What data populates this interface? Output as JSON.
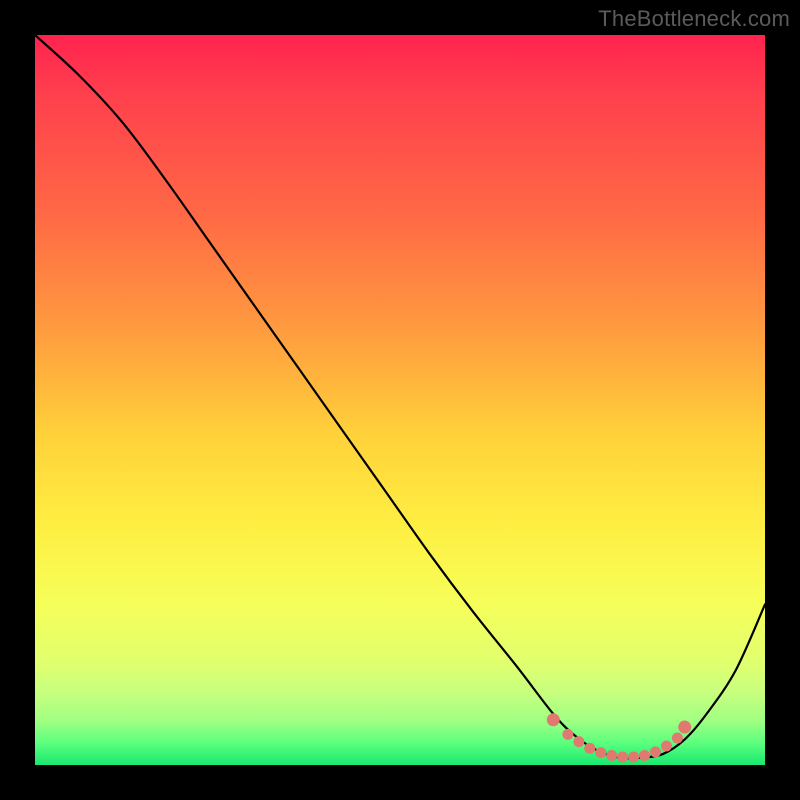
{
  "watermark": "TheBottleneck.com",
  "chart_data": {
    "type": "line",
    "title": "",
    "xlabel": "",
    "ylabel": "",
    "xlim": [
      0,
      100
    ],
    "ylim": [
      0,
      100
    ],
    "series": [
      {
        "name": "curve",
        "x": [
          0,
          6,
          12,
          18,
          24,
          30,
          36,
          42,
          48,
          54,
          60,
          66,
          71,
          74,
          77,
          80,
          83,
          86,
          89,
          92,
          96,
          100
        ],
        "y": [
          100,
          94.5,
          88,
          80,
          71.5,
          63,
          54.5,
          46,
          37.5,
          29,
          21,
          13.5,
          7,
          4,
          2,
          1,
          1,
          1.5,
          3.5,
          7,
          13,
          22
        ]
      },
      {
        "name": "highlight-dots",
        "x": [
          71,
          73,
          74.5,
          76,
          77.5,
          79,
          80.5,
          82,
          83.5,
          85,
          86.5,
          88,
          89
        ],
        "y": [
          6.2,
          4.2,
          3.2,
          2.3,
          1.7,
          1.3,
          1.1,
          1.1,
          1.3,
          1.8,
          2.6,
          3.7,
          5.2
        ]
      }
    ],
    "colors": {
      "curve": "#000000",
      "highlight": "#e0796f"
    }
  }
}
